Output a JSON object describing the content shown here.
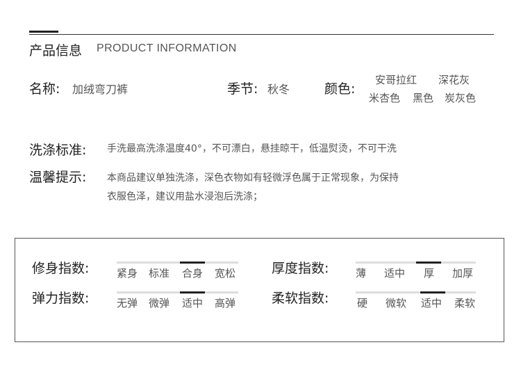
{
  "header": {
    "title_cn": "产品信息",
    "title_en": "PRODUCT INFORMATION"
  },
  "name": {
    "label": "名称:",
    "value": "加绒弯刀裤"
  },
  "season": {
    "label": "季节:",
    "value": "秋冬"
  },
  "colors": {
    "label": "颜色:",
    "options": [
      "安哥拉红",
      "深花灰",
      "米杏色",
      "黑色",
      "炭灰色"
    ]
  },
  "washing": {
    "label": "洗涤标准:",
    "value": "手洗最高洗涤温度40°，不可漂白，悬挂晾干，低温熨烫，不可干洗"
  },
  "tips": {
    "label": "温馨提示:",
    "line1": "本商品建议单独洗涤，深色衣物如有轻微浮色属于正常现象，为保持",
    "line2": "衣服色泽，建议用盐水浸泡后洗涤；"
  },
  "indices": {
    "fit": {
      "label": "修身指数:",
      "options": [
        "紧身",
        "标准",
        "合身",
        "宽松"
      ],
      "selected": 2
    },
    "thickness": {
      "label": "厚度指数:",
      "options": [
        "薄",
        "适中",
        "厚",
        "加厚"
      ],
      "selected": 2
    },
    "elasticity": {
      "label": "弹力指数:",
      "options": [
        "无弹",
        "微弹",
        "适中",
        "高弹"
      ],
      "selected": 2
    },
    "softness": {
      "label": "柔软指数:",
      "options": [
        "硬",
        "微软",
        "适中",
        "柔软"
      ],
      "selected": 2
    }
  }
}
